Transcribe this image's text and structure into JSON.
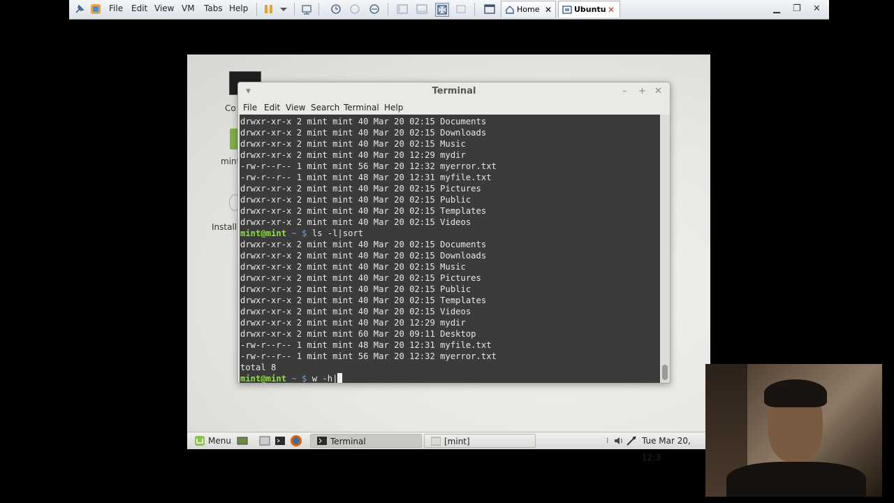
{
  "vmware": {
    "menu": [
      "File",
      "Edit",
      "View",
      "VM",
      "Tabs",
      "Help"
    ],
    "tabs": [
      {
        "label": "Home",
        "active": false
      },
      {
        "label": "Ubuntu",
        "active": true
      }
    ]
  },
  "desktop": {
    "icons": [
      "Co",
      "mint",
      "Install"
    ]
  },
  "terminal": {
    "title": "Terminal",
    "menu": [
      "File",
      "Edit",
      "View",
      "Search",
      "Terminal",
      "Help"
    ],
    "prompt": "mint@mint",
    "prompt_sep": " ~ $",
    "lines": [
      {
        "t": "out",
        "text": "drwxr-xr-x 2 mint mint 40 Mar 20 02:15 Documents"
      },
      {
        "t": "out",
        "text": "drwxr-xr-x 2 mint mint 40 Mar 20 02:15 Downloads"
      },
      {
        "t": "out",
        "text": "drwxr-xr-x 2 mint mint 40 Mar 20 02:15 Music"
      },
      {
        "t": "out",
        "text": "drwxr-xr-x 2 mint mint 40 Mar 20 12:29 mydir"
      },
      {
        "t": "out",
        "text": "-rw-r--r-- 1 mint mint 56 Mar 20 12:32 myerror.txt"
      },
      {
        "t": "out",
        "text": "-rw-r--r-- 1 mint mint 48 Mar 20 12:31 myfile.txt"
      },
      {
        "t": "out",
        "text": "drwxr-xr-x 2 mint mint 40 Mar 20 02:15 Pictures"
      },
      {
        "t": "out",
        "text": "drwxr-xr-x 2 mint mint 40 Mar 20 02:15 Public"
      },
      {
        "t": "out",
        "text": "drwxr-xr-x 2 mint mint 40 Mar 20 02:15 Templates"
      },
      {
        "t": "out",
        "text": "drwxr-xr-x 2 mint mint 40 Mar 20 02:15 Videos"
      },
      {
        "t": "cmd",
        "text": "ls -l|sort"
      },
      {
        "t": "out",
        "text": "drwxr-xr-x 2 mint mint 40 Mar 20 02:15 Documents"
      },
      {
        "t": "out",
        "text": "drwxr-xr-x 2 mint mint 40 Mar 20 02:15 Downloads"
      },
      {
        "t": "out",
        "text": "drwxr-xr-x 2 mint mint 40 Mar 20 02:15 Music"
      },
      {
        "t": "out",
        "text": "drwxr-xr-x 2 mint mint 40 Mar 20 02:15 Pictures"
      },
      {
        "t": "out",
        "text": "drwxr-xr-x 2 mint mint 40 Mar 20 02:15 Public"
      },
      {
        "t": "out",
        "text": "drwxr-xr-x 2 mint mint 40 Mar 20 02:15 Templates"
      },
      {
        "t": "out",
        "text": "drwxr-xr-x 2 mint mint 40 Mar 20 02:15 Videos"
      },
      {
        "t": "out",
        "text": "drwxr-xr-x 2 mint mint 40 Mar 20 12:29 mydir"
      },
      {
        "t": "out",
        "text": "drwxr-xr-x 2 mint mint 60 Mar 20 09:11 Desktop"
      },
      {
        "t": "out",
        "text": "-rw-r--r-- 1 mint mint 48 Mar 20 12:31 myfile.txt"
      },
      {
        "t": "out",
        "text": "-rw-r--r-- 1 mint mint 56 Mar 20 12:32 myerror.txt"
      },
      {
        "t": "out",
        "text": "total 8"
      },
      {
        "t": "input",
        "text": "w -h|"
      }
    ]
  },
  "taskbar": {
    "menu_label": "Menu",
    "windows": [
      "Terminal",
      "[mint]"
    ],
    "clock": "Tue Mar 20, 12:3"
  }
}
